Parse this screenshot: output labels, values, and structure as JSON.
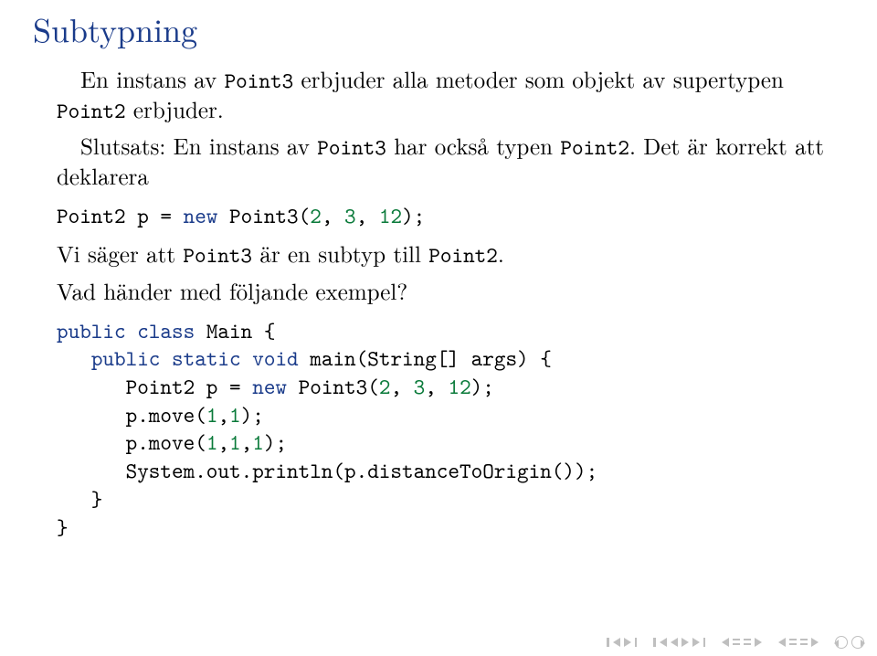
{
  "title": "Subtypning",
  "para1": {
    "pre1": "En instans av ",
    "code1": "Point3",
    "mid1": " erbjuder alla metoder som objekt av supertypen ",
    "code2": "Point2",
    "post": " erbjuder."
  },
  "para2": {
    "pre": "Slutsats: En instans av ",
    "code1": "Point3",
    "mid": " har också typen ",
    "code2": "Point2",
    "post": ". Det är korrekt att deklarera"
  },
  "decl": {
    "t1": "Point2 p = ",
    "kw_new": "new",
    "t2": " Point3(",
    "n1": "2",
    "c1": ", ",
    "n2": "3",
    "c2": ", ",
    "n3": "12",
    "t3": ");"
  },
  "para3": {
    "pre": "Vi säger att ",
    "code1": "Point3",
    "mid": " är en subtyp till ",
    "code2": "Point2",
    "post": "."
  },
  "para4": "Vad händer med följande exempel?",
  "code": {
    "l1_kw1": "public",
    "l1_kw2": "class",
    "l1_rest": " Main {",
    "l2_pad": "   ",
    "l2_kw1": "public",
    "l2_kw2": "static",
    "l2_kw3": "void",
    "l2_rest": " main(String[] args) {",
    "l3_pad": "      ",
    "l3_t1": "Point2 p = ",
    "l3_kw": "new",
    "l3_t2": " Point3(",
    "l3_n1": "2",
    "l3_c1": ", ",
    "l3_n2": "3",
    "l3_c2": ", ",
    "l3_n3": "12",
    "l3_t3": ");",
    "l4_pad": "      ",
    "l4_t1": "p.move(",
    "l4_n1": "1",
    "l4_c1": ",",
    "l4_n2": "1",
    "l4_t2": ");",
    "l5_pad": "      ",
    "l5_t1": "p.move(",
    "l5_n1": "1",
    "l5_c1": ",",
    "l5_n2": "1",
    "l5_c2": ",",
    "l5_n3": "1",
    "l5_t2": ");",
    "l6_pad": "      ",
    "l6_t1": "System.out.println(p.distanceToOrigin());",
    "l7": "   }",
    "l8": "}"
  }
}
